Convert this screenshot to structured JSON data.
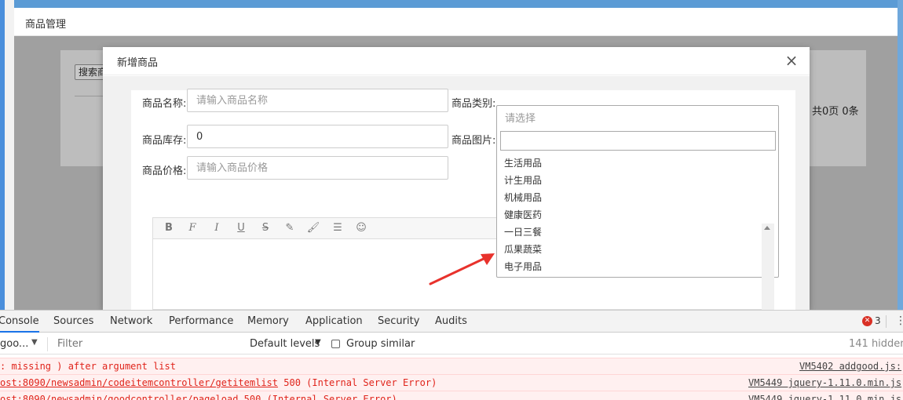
{
  "page": {
    "title": "商品管理",
    "search_button": "搜索商",
    "pager": "共0页 0条"
  },
  "modal": {
    "title": "新增商品",
    "close": "×",
    "fields": {
      "name_label": "商品名称:",
      "name_placeholder": "请输入商品名称",
      "category_label": "商品类别:",
      "stock_label": "商品库存:",
      "stock_value": "0",
      "image_label": "商品图片:",
      "price_label": "商品价格:",
      "price_placeholder": "请输入商品价格"
    },
    "editor_toolbar": [
      "B",
      "F",
      "I",
      "U",
      "S",
      "pencil",
      "brush",
      "align",
      "emoji"
    ]
  },
  "dropdown": {
    "placeholder": "请选择",
    "search_value": "",
    "options": [
      "生活用品",
      "计生用品",
      "机械用品",
      "健康医药",
      "一日三餐",
      "瓜果蔬菜",
      "电子用品"
    ]
  },
  "devtools": {
    "tabs": [
      "Console",
      "Sources",
      "Network",
      "Performance",
      "Memory",
      "Application",
      "Security",
      "Audits"
    ],
    "error_count": "3",
    "context": "goo...",
    "filter_placeholder": "Filter",
    "levels": "Default levels",
    "group_similar": "Group similar",
    "hidden": "141 hidden",
    "messages": [
      {
        "text": ": missing ) after argument list",
        "status": "",
        "source": "VM5402 addgood.js:"
      },
      {
        "text": "ost:8090/newsadmin/codeitemcontroller/getitemlist",
        "status": "500 (Internal Server Error)",
        "source": "VM5449 jquery-1.11.0.min.js"
      },
      {
        "text": "ost:8090/newsadmin/goodcontroller/pageload",
        "status": "500 (Internal Server Error)",
        "source": "VM5449 jquery-1.11.0.min.js"
      }
    ]
  },
  "colors": {
    "accent": "#4a8fdc",
    "error": "#e0241b",
    "arrow": "#e8322c"
  }
}
